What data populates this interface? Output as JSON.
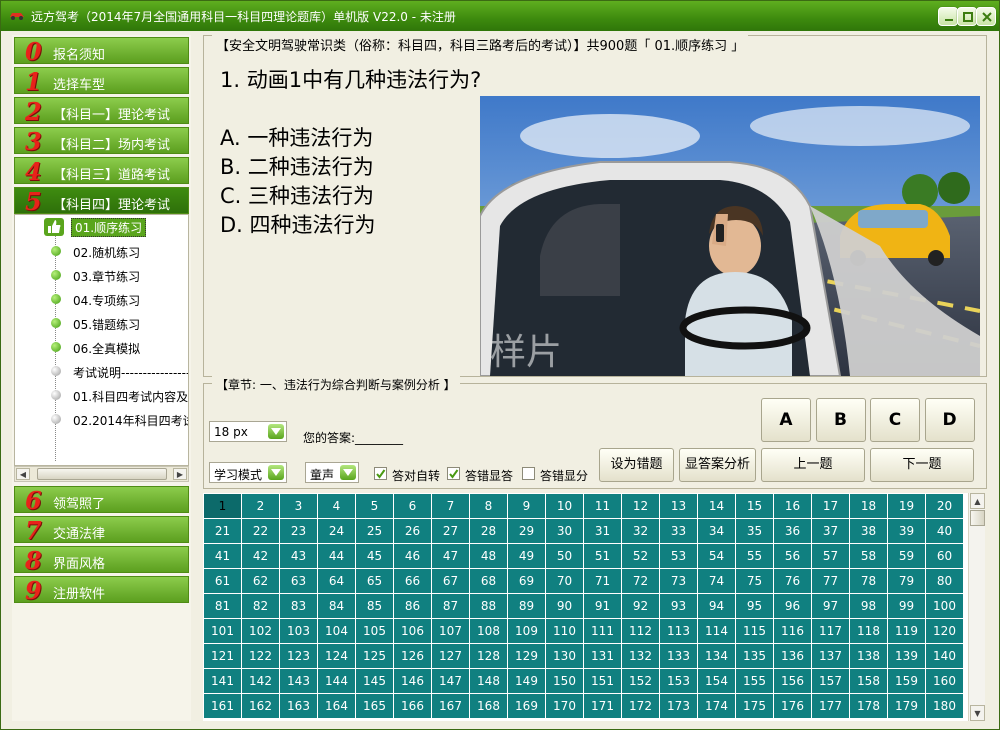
{
  "window": {
    "title": "远方驾考（2014年7月全国通用科目一科目四理论题库）单机版  V22.0 - 未注册"
  },
  "sidebar": {
    "top_items": [
      {
        "num": "0",
        "label": "报名须知"
      },
      {
        "num": "1",
        "label": "选择车型"
      },
      {
        "num": "2",
        "label": "【科目一】理论考试"
      },
      {
        "num": "3",
        "label": "【科目二】场内考试"
      },
      {
        "num": "4",
        "label": "【科目三】道路考试"
      },
      {
        "num": "5",
        "label": "【科目四】理论考试"
      }
    ],
    "tree_items": [
      {
        "label": "01.顺序练习",
        "selected": true
      },
      {
        "label": "02.随机练习"
      },
      {
        "label": "03.章节练习"
      },
      {
        "label": "04.专项练习"
      },
      {
        "label": "05.错题练习"
      },
      {
        "label": "06.全真模拟"
      },
      {
        "label": "考试说明------------------------"
      },
      {
        "label": "01.科目四考试内容及合"
      },
      {
        "label": "02.2014年科目四考试"
      }
    ],
    "bottom_items": [
      {
        "num": "6",
        "label": "领驾照了"
      },
      {
        "num": "7",
        "label": "交通法律"
      },
      {
        "num": "8",
        "label": "界面风格"
      },
      {
        "num": "9",
        "label": "注册软件"
      }
    ]
  },
  "question": {
    "header": "【安全文明驾驶常识类（俗称：科目四，科目三路考后的考试）】共900题「 01.顺序练习 」",
    "text": "1. 动画1中有几种违法行为?",
    "options": [
      "A. 一种违法行为",
      "B. 二种违法行为",
      "C. 三种违法行为",
      "D. 四种违法行为"
    ],
    "image_watermark": "样片"
  },
  "controls": {
    "chapter": "【章节: 一、违法行为综合判断与案例分析 】",
    "font_size": "18 px",
    "answer_label": "您的答案:________",
    "mode": "学习模式",
    "voice": "童声",
    "checks": [
      {
        "label": "答对自转",
        "checked": true
      },
      {
        "label": "答错显答",
        "checked": true
      },
      {
        "label": "答错显分",
        "checked": false
      }
    ],
    "set_wrong_button": "设为错题",
    "show_analysis_button": "显答案分析",
    "prev_button": "上一题",
    "next_button": "下一题",
    "answers": [
      "A",
      "B",
      "C",
      "D"
    ]
  },
  "grid": {
    "numbers": [
      "1",
      "2",
      "3",
      "4",
      "5",
      "6",
      "7",
      "8",
      "9",
      "10",
      "11",
      "12",
      "13",
      "14",
      "15",
      "16",
      "17",
      "18",
      "19",
      "20",
      "21",
      "22",
      "23",
      "24",
      "25",
      "26",
      "27",
      "28",
      "29",
      "30",
      "31",
      "32",
      "33",
      "34",
      "35",
      "36",
      "37",
      "38",
      "39",
      "40",
      "41",
      "42",
      "43",
      "44",
      "45",
      "46",
      "47",
      "48",
      "49",
      "50",
      "51",
      "52",
      "53",
      "54",
      "55",
      "56",
      "57",
      "58",
      "59",
      "60",
      "61",
      "62",
      "63",
      "64",
      "65",
      "66",
      "67",
      "68",
      "69",
      "70",
      "71",
      "72",
      "73",
      "74",
      "75",
      "76",
      "77",
      "78",
      "79",
      "80",
      "81",
      "82",
      "83",
      "84",
      "85",
      "86",
      "87",
      "88",
      "89",
      "90",
      "91",
      "92",
      "93",
      "94",
      "95",
      "96",
      "97",
      "98",
      "99",
      "100",
      "101",
      "102",
      "103",
      "104",
      "105",
      "106",
      "107",
      "108",
      "109",
      "110",
      "111",
      "112",
      "113",
      "114",
      "115",
      "116",
      "117",
      "118",
      "119",
      "120",
      "121",
      "122",
      "123",
      "124",
      "125",
      "126",
      "127",
      "128",
      "129",
      "130",
      "131",
      "132",
      "133",
      "134",
      "135",
      "136",
      "137",
      "138",
      "139",
      "140",
      "141",
      "142",
      "143",
      "144",
      "145",
      "146",
      "147",
      "148",
      "149",
      "150",
      "151",
      "152",
      "153",
      "154",
      "155",
      "156",
      "157",
      "158",
      "159",
      "160",
      "161",
      "162",
      "163",
      "164",
      "165",
      "166",
      "167",
      "168",
      "169",
      "170",
      "171",
      "172",
      "173",
      "174",
      "175",
      "176",
      "177",
      "178",
      "179",
      "180"
    ],
    "current": "1"
  },
  "colors": {
    "accent_green": "#5c9f1f",
    "grid_teal": "#108080",
    "number_red": "#e8231a"
  }
}
